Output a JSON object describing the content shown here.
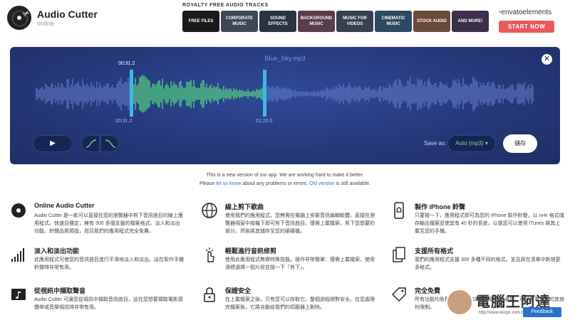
{
  "header": {
    "app_title": "Audio Cutter",
    "app_subtitle": "online",
    "logo_icon": "scissors-record-icon"
  },
  "ad": {
    "title": "ROYALTY FREE AUDIO TRACKS",
    "tiles": [
      {
        "label": "FREE FILES",
        "color": "#1a1a1a"
      },
      {
        "label": "CORPORATE MUSIC",
        "color": "#3f4756"
      },
      {
        "label": "SOUND EFFECTS",
        "color": "#2c3340"
      },
      {
        "label": "BACKGROUND MUSIC",
        "color": "#5a3d4c"
      },
      {
        "label": "MUSIC FOR VIDEOS",
        "color": "#36404e"
      },
      {
        "label": "CINEMATIC MUSIC",
        "color": "#2b4a62"
      },
      {
        "label": "STOCK AUDIO",
        "color": "#6a4a3a"
      },
      {
        "label": "AND MORE!",
        "color": "#3b2f4a"
      }
    ],
    "brand_prefix": "•",
    "brand_name": "envato",
    "brand_suffix": "elements",
    "cta": "START NOW"
  },
  "editor": {
    "filename": "Blue_Sky.mp3",
    "close_icon": "close-icon",
    "time_cursor": "00:31.2",
    "time_start": "00:31.2",
    "time_end": "01:20.0",
    "selection": {
      "start_fraction": 0.195,
      "end_fraction": 0.455
    },
    "play_icon": "▶",
    "save_as_label": "Save as:",
    "format_value": "Auto (mp3)",
    "format_caret": "▾",
    "save_label": "儲存",
    "colors": {
      "selected_wave": "#58e07f",
      "unselected_wave": "#5d78c2",
      "handle": "#3fb7e7"
    }
  },
  "notice": {
    "line1": "This is a new version of our app. We are working hard to make it better.",
    "please": "Please",
    "let_us_know": "let us know",
    "middle": "about any problems or errors.",
    "old_version": "Old version",
    "end": "is still available."
  },
  "features": [
    {
      "title": "Online Audio Cutter",
      "desc": "Audio Cutter 是一款可以直接在您的瀏覽器中剪下音訊曲目的線上應用程式。快速且穩定，擁有 300 多個支援的檔案格式、淡入和淡出功能、鈴聲品質預設，而且我們的應用程式完全免費。",
      "icon": "record-scissors-icon"
    },
    {
      "title": "線上剪下歌曲",
      "desc": "使用我們的應用程式，您無需在電腦上安裝音訊編輯軟體，直接在瀏覽器視窗中按幾下即可剪下音訊曲目。僅需上載檔案，剪下您想要的部分，然後將其儲存至您的硬碟機。",
      "icon": "globe-icon"
    },
    {
      "title": "製作 iPhone 鈴聲",
      "desc": "只要按一下，應用程式即可為您的 iPhone 製作鈴聲，以 m4r 格式儲存輸出檔案並使其有 40 秒的長度，以便您可以使用 iTunes 將其上載至您的手機。",
      "icon": "phone-bell-icon"
    },
    {
      "title": "淡入和淡出功能",
      "desc": "此應用程式可使您的音訊曲目進行平滑地淡入和淡出。這在製作手機鈴聲時非常有用。",
      "icon": "fade-bars-icon"
    },
    {
      "title": "輕鬆進行音訊修剪",
      "desc": "使用此應用程式無需特殊技能。操作非常簡單：僅需上載檔案、使用滑標選擇一個片段並按一下「剪下」。",
      "icon": "tap-hand-icon"
    },
    {
      "title": "支援所有格式",
      "desc": "我們的應用程式支援 300 多種不同的格式，並且將在清單中新增更多格式。",
      "icon": "files-icon"
    },
    {
      "title": "從視訊中擷取聲音",
      "desc": "Audio Cutter 可讓您從視訊中擷取音訊曲目，這在您想要擷取電影原聲帶或音樂視訊時非常有用。",
      "icon": "video-note-icon"
    },
    {
      "title": "保證安全",
      "desc": "在上載檔案之後，只有您可以存取它。整個過程絕對安全。在您處理完檔案後，它將自動從我們的伺服器上刪除。",
      "icon": "lock-icon"
    },
    {
      "title": "完全免費",
      "desc": "所有功能均免費提供，但如果您想要更多選擇，可以查看我們的其他何限制。",
      "icon": "free-tag-icon"
    }
  ],
  "watermark": {
    "text": "電腦王阿達",
    "url": "http://www.kocpc.com.tw"
  },
  "feedback": "Feedback"
}
